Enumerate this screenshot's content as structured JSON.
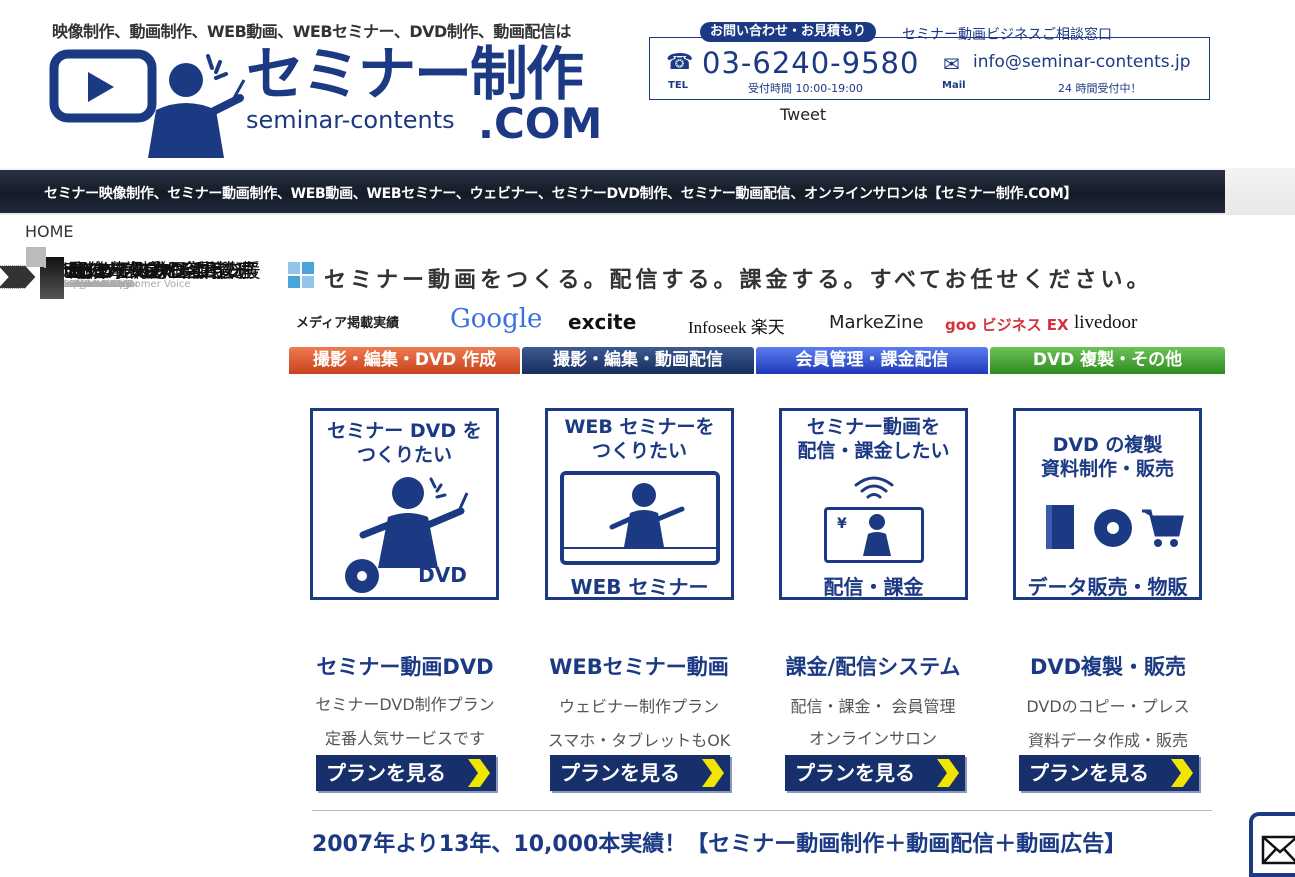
{
  "header": {
    "tagline": "映像制作、動画制作、WEB動画、WEBセミナー、DVD制作、動画配信は",
    "logo_ja": "セミナー制作",
    "logo_en": "seminar-contents",
    "logo_com": ".COM",
    "contact": {
      "tag": "お問い合わせ・お見積もり",
      "title": "セミナー動画ビジネスご相談窓口",
      "phone": "03-6240-9580",
      "tel_label": "TEL",
      "hours": "受付時間 10:00-19:00",
      "email": "info@seminar-contents.jp",
      "mail_label": "Mail",
      "hours_24": "24 時間受付中！"
    },
    "tweet": "Tweet"
  },
  "band": {
    "text": "セミナー映像制作、セミナー動画制作、WEB動画、WEBセミナー、ウェビナー、セミナーDVD制作、セミナー動画配信、オンラインサロンは【セミナー制作.COM】"
  },
  "breadcrumb": "HOME",
  "sidebar": {
    "items": [
      {
        "label": "はじめての方へ",
        "sub": "First Contact"
      },
      {
        "label": "セミナースタジオ",
        "sub": "seminar studio"
      },
      {
        "label": "ライブセミナー",
        "sub": "SEMINAR LIVE"
      },
      {
        "label": "WEB セミナー",
        "sub": "online seminar"
      },
      {
        "label": "セミナー DVD",
        "sub": "seminar DVD"
      },
      {
        "label": "セミナーダイジェスト",
        "sub": "Dijest"
      },
      {
        "label": "配信・課金・会員管理",
        "sub": "digistream"
      },
      {
        "label": "DVD プレス／コピー",
        "sub": "press&copy"
      },
      {
        "label": "制作事例／お客様の声",
        "sub": "works&Customer Voice"
      },
      {
        "label": "セミナー動画活用支援",
        "sub": "consulting"
      }
    ]
  },
  "hero": "セミナー動画をつくる。配信する。課金する。すべてお任せください。",
  "media": {
    "label": "メディア掲載実績",
    "logos": [
      "Google",
      "excite",
      "Infoseek 楽天",
      "MarkeZine",
      "goo ビジネス EX",
      "livedoor"
    ]
  },
  "categories": [
    {
      "label": "撮影・編集・DVD 作成",
      "color": "#d9542b"
    },
    {
      "label": "撮影・編集・動画配信",
      "color": "#1f3a70"
    },
    {
      "label": "会員管理・課金配信",
      "color": "#2b48c8"
    },
    {
      "label": "DVD 複製・その他",
      "color": "#3f9a2e"
    }
  ],
  "services": [
    {
      "box_title": "セミナー DVD を\nつくりたい",
      "box_foot": "DVD",
      "title": "セミナー動画DVD",
      "desc1": "セミナーDVD制作プラン",
      "desc2": "定番人気サービスです",
      "button": "プランを見る"
    },
    {
      "box_title": "WEB セミナーを\nつくりたい",
      "box_foot": "WEB セミナー",
      "title": "WEBセミナー動画",
      "desc1": "ウェビナー制作プラン",
      "desc2": "スマホ・タブレットもOK",
      "button": "プランを見る"
    },
    {
      "box_title": "セミナー動画を\n配信・課金したい",
      "box_foot": "配信・課金",
      "title": "課金/配信システム",
      "desc1": "配信・課金・ 会員管理",
      "desc2": "オンラインサロン",
      "button": "プランを見る"
    },
    {
      "box_title": "DVD の複製\n資料制作・販売",
      "box_foot": "データ販売・物販",
      "title": "DVD複製・販売",
      "desc1": "DVDのコピー・プレス",
      "desc2": "資料データ作成・販売",
      "button": "プランを見る"
    }
  ],
  "summary": "2007年より13年、10,000本実績！【セミナー動画制作＋動画配信＋動画広告】",
  "colors": {
    "brand": "#1c3a84",
    "accent": "#f2e600"
  }
}
